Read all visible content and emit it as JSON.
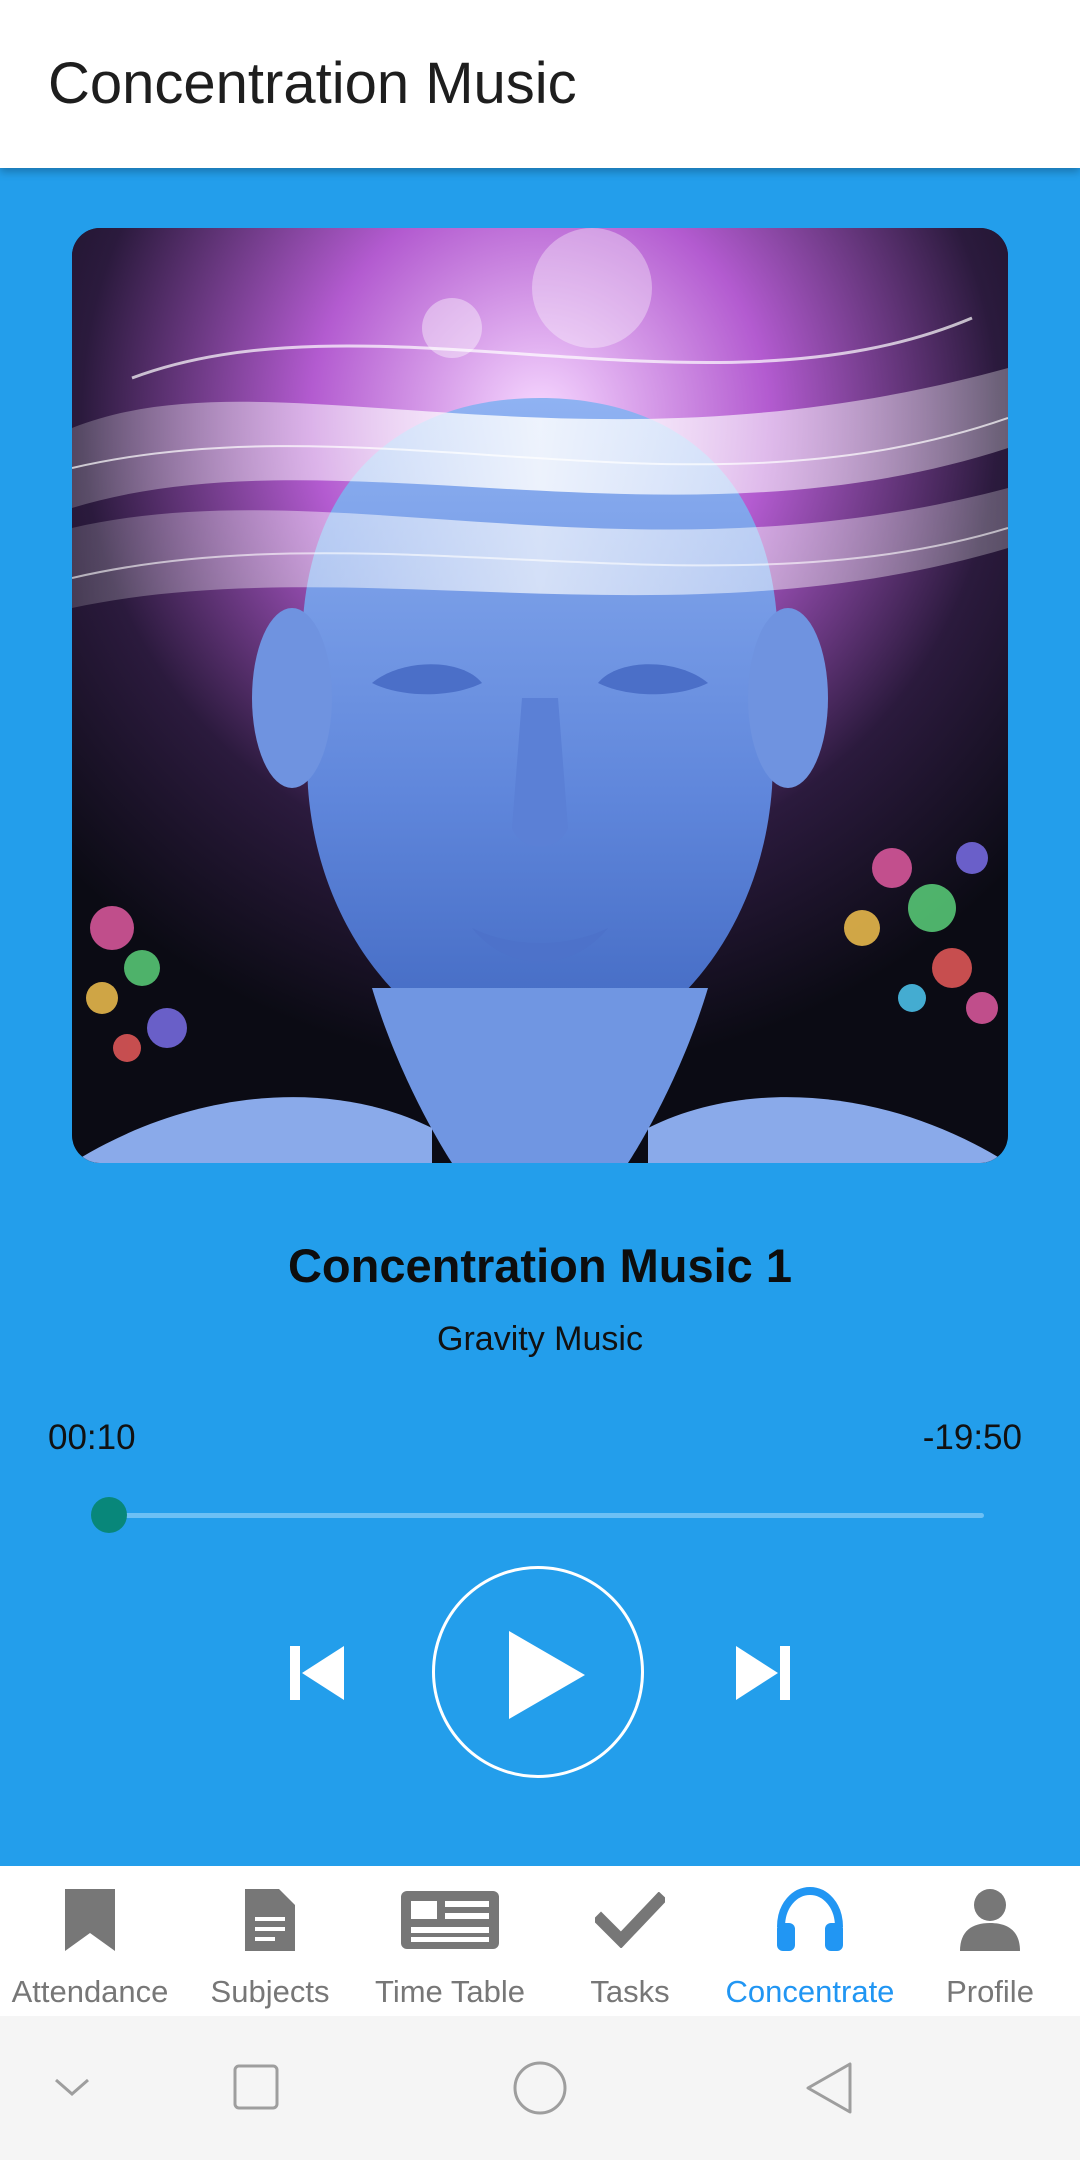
{
  "app_bar": {
    "title": "Concentration Music"
  },
  "player": {
    "track_title": "Concentration Music 1",
    "artist": "Gravity Music",
    "elapsed": "00:10",
    "remaining": "-19:50",
    "progress_fraction": 0.008,
    "controls": {
      "previous_icon": "skip-previous-icon",
      "play_icon": "play-icon",
      "next_icon": "skip-next-icon"
    }
  },
  "bottom_nav": {
    "active": "Concentrate",
    "active_color": "#2196F3",
    "items": [
      {
        "label": "Attendance",
        "icon": "bookmark-icon"
      },
      {
        "label": "Subjects",
        "icon": "document-icon"
      },
      {
        "label": "Time Table",
        "icon": "newspaper-icon"
      },
      {
        "label": "Tasks",
        "icon": "checkmark-icon"
      },
      {
        "label": "Concentrate",
        "icon": "headphones-icon"
      },
      {
        "label": "Profile",
        "icon": "person-icon"
      }
    ]
  },
  "system_nav": {
    "buttons": [
      "chevron-down-icon",
      "recents-square-icon",
      "home-circle-icon",
      "back-triangle-icon"
    ]
  },
  "colors": {
    "background": "#239EEB",
    "seek_thumb": "#08877a",
    "inactive_nav": "#777777"
  }
}
